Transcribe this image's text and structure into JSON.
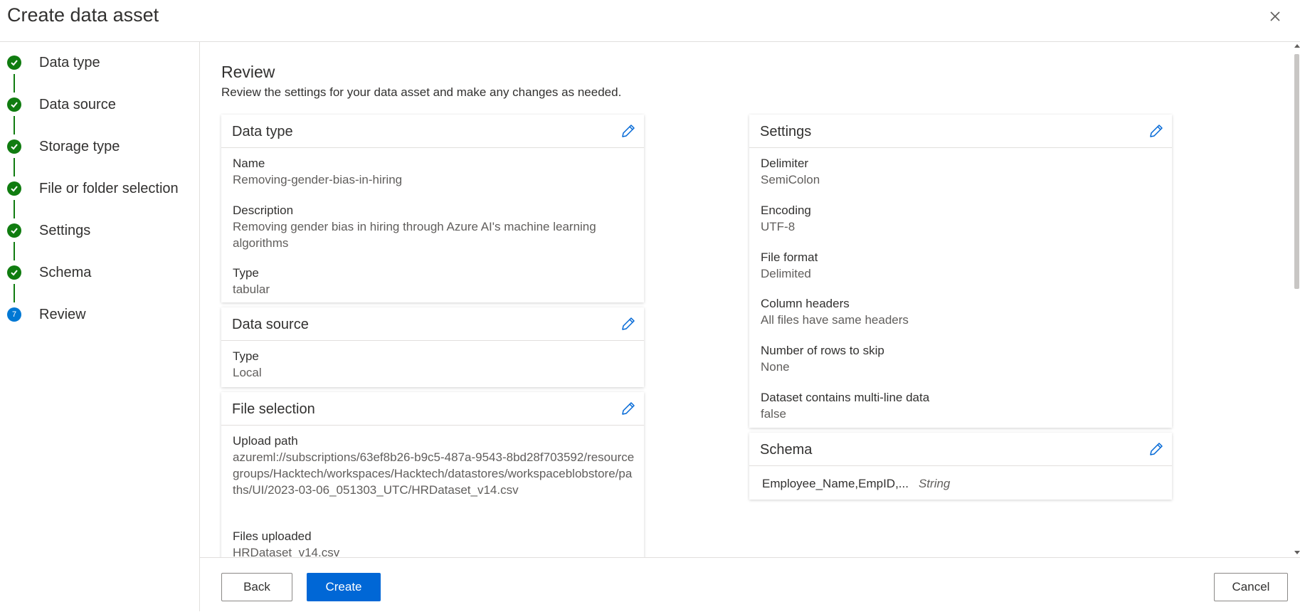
{
  "window": {
    "title": "Create data asset"
  },
  "steps": [
    {
      "label": "Data type",
      "status": "complete"
    },
    {
      "label": "Data source",
      "status": "complete"
    },
    {
      "label": "Storage type",
      "status": "complete"
    },
    {
      "label": "File or folder selection",
      "status": "complete"
    },
    {
      "label": "Settings",
      "status": "complete"
    },
    {
      "label": "Schema",
      "status": "complete"
    },
    {
      "label": "Review",
      "status": "current",
      "number": "7"
    }
  ],
  "review": {
    "title": "Review",
    "description": "Review the settings for your data asset and make any changes as needed."
  },
  "cards": {
    "data_type": {
      "title": "Data type",
      "name_label": "Name",
      "name_value": "Removing-gender-bias-in-hiring",
      "description_label": "Description",
      "description_value": "Removing gender bias in hiring through Azure AI's machine learning algorithms",
      "type_label": "Type",
      "type_value": "tabular"
    },
    "data_source": {
      "title": "Data source",
      "type_label": "Type",
      "type_value": "Local"
    },
    "file_selection": {
      "title": "File selection",
      "upload_path_label": "Upload path",
      "upload_path_value": "azureml://subscriptions/63ef8b26-b9c5-487a-9543-8bd28f703592/resourcegroups/Hacktech/workspaces/Hacktech/datastores/workspaceblobstore/paths/UI/2023-03-06_051303_UTC/HRDataset_v14.csv",
      "files_uploaded_label": "Files uploaded",
      "files_uploaded_value": "HRDataset_v14.csv"
    },
    "settings": {
      "title": "Settings",
      "delimiter_label": "Delimiter",
      "delimiter_value": "SemiColon",
      "encoding_label": "Encoding",
      "encoding_value": "UTF-8",
      "file_format_label": "File format",
      "file_format_value": "Delimited",
      "column_headers_label": "Column headers",
      "column_headers_value": "All files have same headers",
      "rows_to_skip_label": "Number of rows to skip",
      "rows_to_skip_value": "None",
      "multiline_label": "Dataset contains multi-line data",
      "multiline_value": "false"
    },
    "schema": {
      "title": "Schema",
      "column_name": "Employee_Name,EmpID,...",
      "column_type": "String"
    }
  },
  "footer": {
    "back_label": "Back",
    "create_label": "Create",
    "cancel_label": "Cancel"
  },
  "colors": {
    "complete": "#107c10",
    "accent": "#0067d6"
  }
}
